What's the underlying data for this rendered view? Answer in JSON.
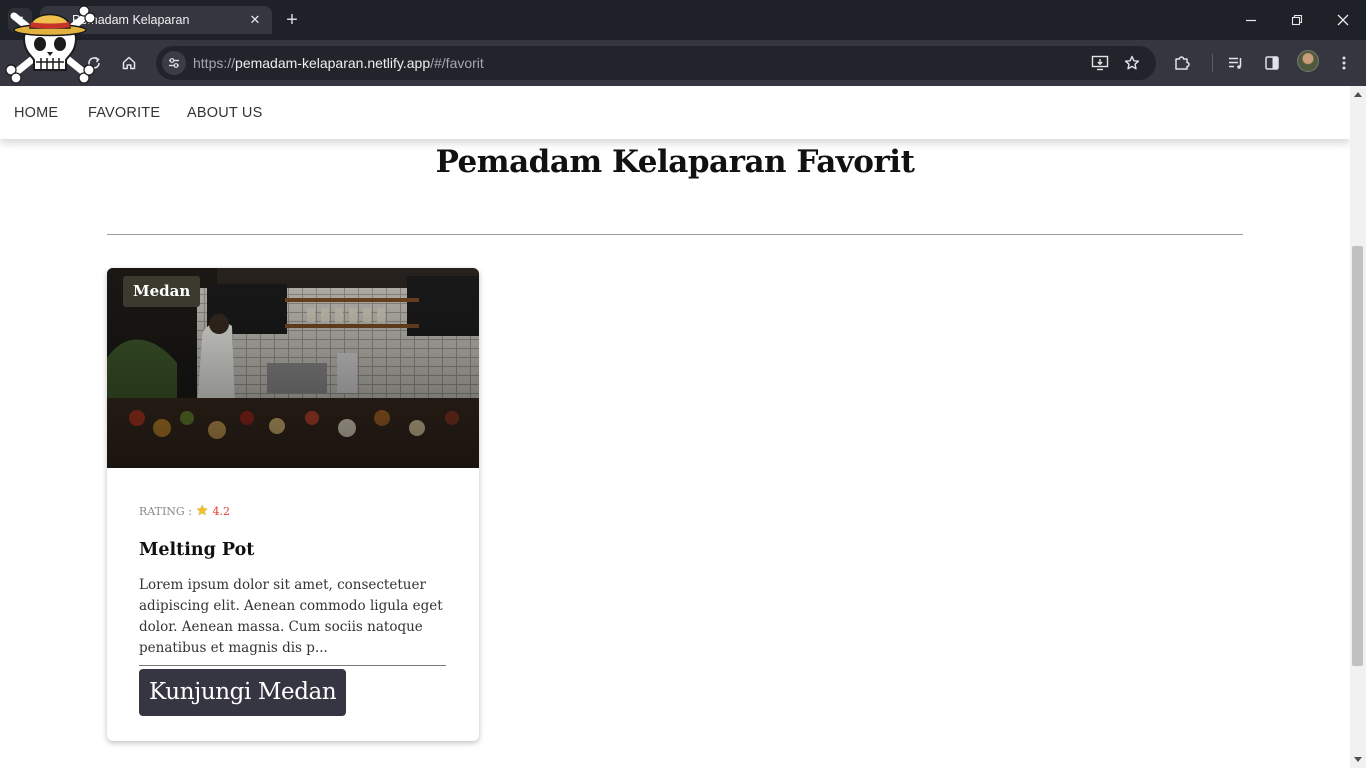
{
  "browser": {
    "tab_title": "Pemadam Kelaparan",
    "url_scheme": "https://",
    "url_host": "pemadam-kelaparan.netlify.app",
    "url_path": "/#/favorit"
  },
  "nav": {
    "items": [
      {
        "label": "HOME"
      },
      {
        "label": "FAVORITE"
      },
      {
        "label": "ABOUT US"
      }
    ]
  },
  "page": {
    "title": "Pemadam Kelaparan Favorit"
  },
  "restaurant": {
    "city": "Medan",
    "rating_label": "RATING :",
    "rating_value": "4.2",
    "name": "Melting Pot",
    "description": "Lorem ipsum dolor sit amet, consectetuer adipiscing elit. Aenean commodo ligula eget dolor. Aenean massa. Cum sociis natoque penatibus et magnis dis p...",
    "visit_button": "Kunjungi Medan"
  },
  "icons": {
    "tab_list": "chevron-down-icon",
    "logo": "skull-strawhat-icon",
    "reload": "reload-icon",
    "home": "home-icon",
    "site_info": "tune-icon",
    "install": "install-icon",
    "bookmark": "star-icon",
    "extensions": "puzzle-icon",
    "media": "media-queue-icon",
    "side_panel": "side-panel-icon",
    "menu": "kebab-menu-icon",
    "rating_star": "star-icon"
  },
  "colors": {
    "chrome_dark": "#1f2128",
    "toolbar": "#35363f",
    "badge_bg": "#3a3a2e",
    "button_bg": "#363642",
    "rating_value": "#e53a2c",
    "star": "#f3c31c"
  }
}
